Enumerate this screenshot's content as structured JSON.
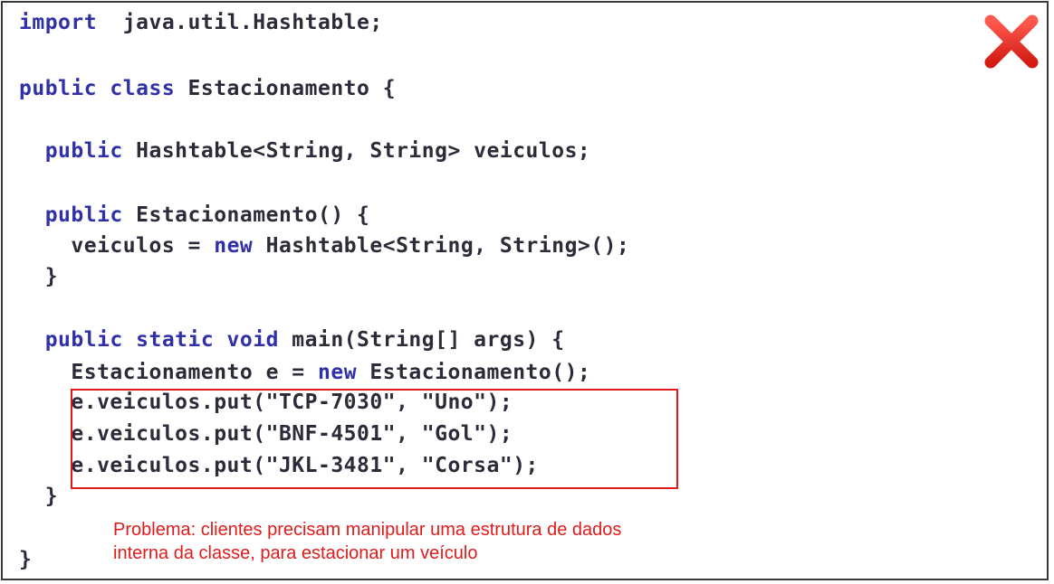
{
  "code_lines": [
    [
      {
        "t": "import",
        "k": "kw"
      },
      {
        "t": "  java.util.Hashtable;",
        "k": "plain"
      }
    ],
    [
      {
        "t": "public class",
        "k": "kw"
      },
      {
        "t": " Estacionamento {",
        "k": "plain"
      }
    ],
    [
      {
        "t": "  public",
        "k": "kw"
      },
      {
        "t": " Hashtable<String, String> veiculos;",
        "k": "plain"
      }
    ],
    [
      {
        "t": "  public",
        "k": "kw"
      },
      {
        "t": " Estacionamento() {",
        "k": "plain"
      }
    ],
    [
      {
        "t": "    veiculos = ",
        "k": "plain"
      },
      {
        "t": "new",
        "k": "kw"
      },
      {
        "t": " Hashtable<String, String>();",
        "k": "plain"
      }
    ],
    [
      {
        "t": "  }",
        "k": "plain"
      }
    ],
    [
      {
        "t": "  public static void",
        "k": "kw"
      },
      {
        "t": " main(String[] args) {",
        "k": "plain"
      }
    ],
    [
      {
        "t": "    Estacionamento e = ",
        "k": "plain"
      },
      {
        "t": "new",
        "k": "kw"
      },
      {
        "t": " Estacionamento();",
        "k": "plain"
      }
    ],
    [
      {
        "t": "    e.veiculos.put(\"TCP-7030\", \"Uno\");",
        "k": "plain"
      }
    ],
    [
      {
        "t": "    e.veiculos.put(\"BNF-4501\", \"Gol\");",
        "k": "plain"
      }
    ],
    [
      {
        "t": "    e.veiculos.put(\"JKL-3481\", \"Corsa\");",
        "k": "plain"
      }
    ],
    [
      {
        "t": "  }",
        "k": "plain"
      }
    ],
    [
      {
        "t": "}",
        "k": "plain"
      }
    ]
  ],
  "note": {
    "line1": "Problema: clientes precisam manipular uma estrutura de dados",
    "line2": "interna da classe, para estacionar um veículo"
  },
  "colors": {
    "keyword": "#3030a8",
    "text": "#2b2b3a",
    "accent_red": "#e01b1b"
  },
  "icons": {
    "status": "x-mark-icon"
  }
}
